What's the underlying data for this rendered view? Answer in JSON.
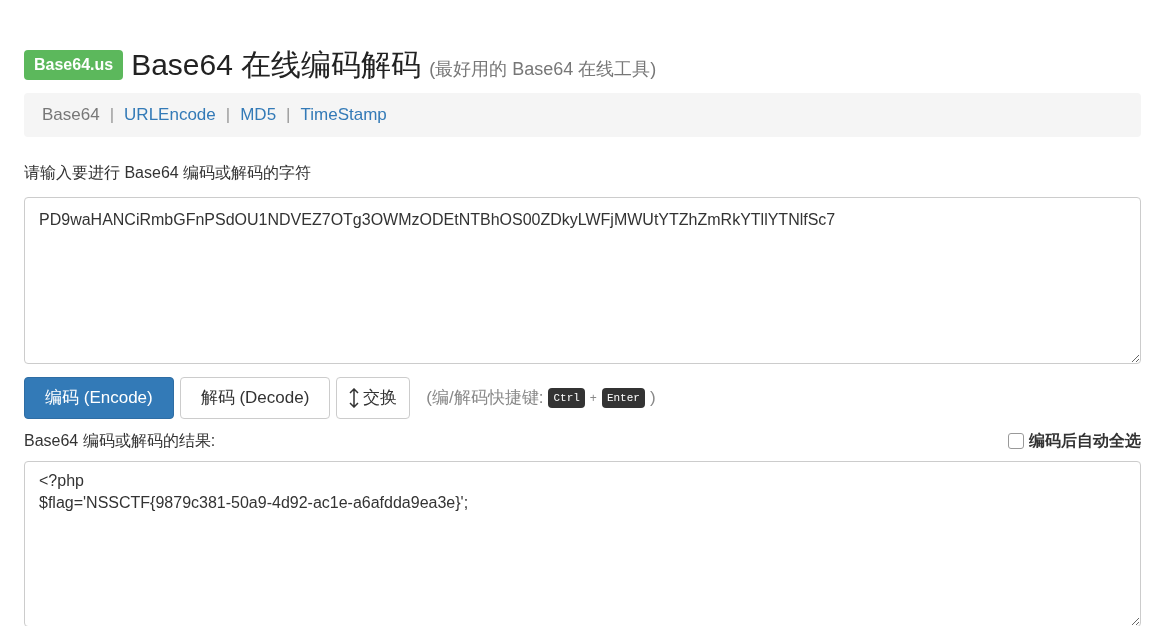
{
  "header": {
    "badge": "Base64.us",
    "title": "Base64 在线编码解码",
    "subtitle": "(最好用的 Base64 在线工具)"
  },
  "nav": [
    {
      "label": "Base64",
      "selected": true
    },
    {
      "separator": "|",
      "label": "URLEncode",
      "selected": false
    },
    {
      "separator": "|",
      "label": "MD5",
      "selected": false
    },
    {
      "separator": "|",
      "label": "TimeStamp",
      "selected": false
    }
  ],
  "input": {
    "label": "请输入要进行 Base64 编码或解码的字符",
    "value": "PD9waHANCiRmbGFnPSdOU1NDVEZ7OTg3OWMzODEtNTBhOS00ZDkyLWFjMWUtYTZhZmRkYTllYTNlfSc7"
  },
  "buttons": [
    {
      "kind": "primary",
      "label": "编码 (Encode)"
    },
    {
      "kind": "default",
      "label": "解码 (Decode)"
    },
    {
      "kind": "swap",
      "label": "交换"
    }
  ],
  "shortcut_hint": {
    "open": "(编/解码快捷键:",
    "keys": [
      "Ctrl",
      "Enter"
    ],
    "joiner": "+",
    "close": ")"
  },
  "output": {
    "label": "Base64 编码或解码的结果:",
    "auto_select": {
      "label": "编码后自动全选",
      "checked": false
    },
    "value": "<?php\n$flag='NSSCTF{9879c381-50a9-4d92-ac1e-a6afdda9ea3e}';"
  }
}
